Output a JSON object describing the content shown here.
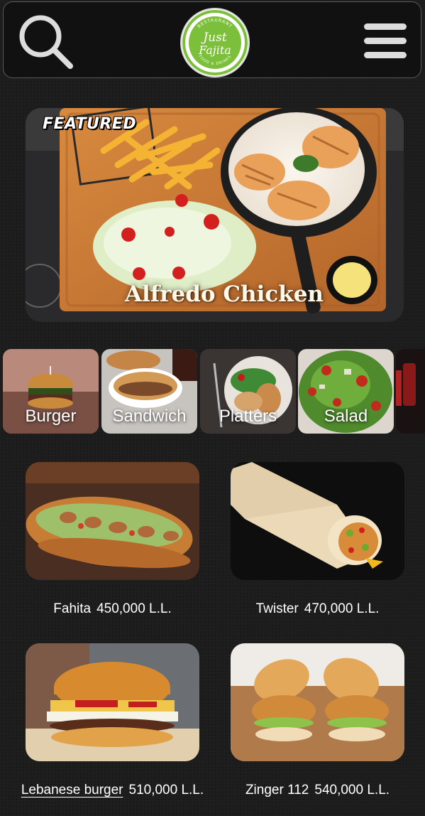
{
  "header": {
    "search_icon": "search-icon",
    "menu_icon": "hamburger-menu-icon",
    "logo": {
      "text_top": "RESTAURANT",
      "line1": "Just",
      "line2": "Fajita",
      "text_bottom": "FOOD & DRINKS"
    }
  },
  "featured": {
    "badge": "FEATURED",
    "title": "Alfredo Chicken"
  },
  "categories": [
    {
      "label": "Burger"
    },
    {
      "label": "Sandwich"
    },
    {
      "label": "Platters"
    },
    {
      "label": "Salad"
    },
    {
      "label": ""
    }
  ],
  "products": [
    {
      "name": "Fahita",
      "price": "450,000 L.L."
    },
    {
      "name": "Twister",
      "price": "470,000 L.L."
    },
    {
      "name": "Lebanese burger",
      "price": "510,000 L.L."
    },
    {
      "name": "Zinger 112",
      "price": "540,000 L.L."
    }
  ],
  "colors": {
    "background": "#1b1b1b",
    "header_bg": "#111111",
    "logo_green": "#7cbf3a",
    "logo_dark": "#3b3b3b"
  }
}
